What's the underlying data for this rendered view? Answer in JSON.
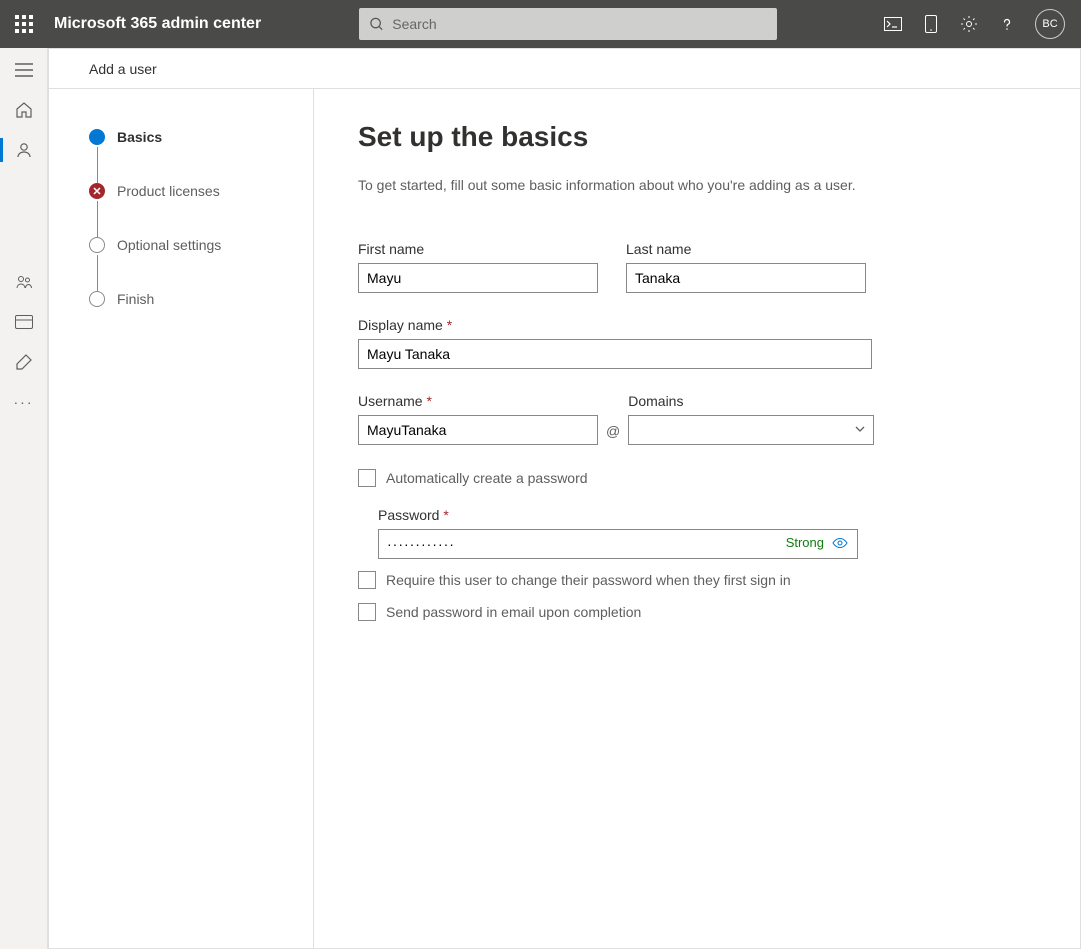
{
  "header": {
    "app_title": "Microsoft 365 admin center",
    "search_placeholder": "Search",
    "avatar_initials": "BC"
  },
  "panel": {
    "title": "Add a user"
  },
  "wizard": {
    "steps": [
      {
        "label": "Basics"
      },
      {
        "label": "Product licenses"
      },
      {
        "label": "Optional settings"
      },
      {
        "label": "Finish"
      }
    ]
  },
  "form": {
    "title": "Set up the basics",
    "subtitle": "To get started, fill out some basic information about who you're adding as a user.",
    "first_name_label": "First name",
    "first_name_value": "Mayu",
    "last_name_label": "Last name",
    "last_name_value": "Tanaka",
    "display_name_label": "Display name",
    "display_name_value": "Mayu Tanaka",
    "username_label": "Username",
    "username_value": "MayuTanaka",
    "domains_label": "Domains",
    "domains_value": "",
    "at": "@",
    "auto_password_label": "Automatically create a password",
    "password_label": "Password",
    "password_value": "············",
    "password_strength": "Strong",
    "require_change_label": "Require this user to change their password when they first sign in",
    "send_email_label": "Send password in email upon completion"
  }
}
